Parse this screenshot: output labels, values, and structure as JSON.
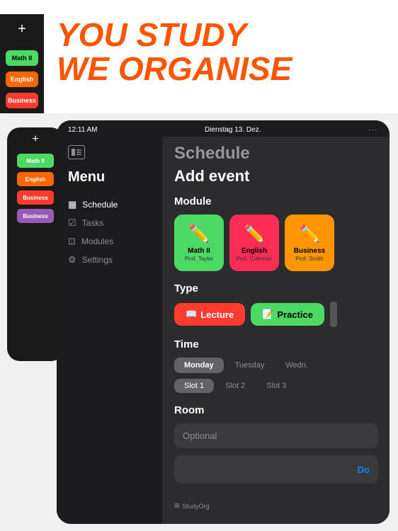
{
  "hero": {
    "headline_line1": "YOU STUDY",
    "headline_line2": "WE ORGANISE"
  },
  "left_strip": {
    "plus": "+",
    "pills": [
      {
        "label": "ath II",
        "color": "green"
      },
      {
        "label": "nglish",
        "color": "orange"
      },
      {
        "label": "iness",
        "color": "red"
      },
      {
        "label": "iness",
        "color": "purple"
      }
    ]
  },
  "ipad": {
    "status": {
      "time": "12:11 AM",
      "date": "Dienstag 13. Dez.",
      "dots": "···"
    },
    "sidebar": {
      "title": "Menu",
      "items": [
        {
          "label": "Schedule",
          "active": true
        },
        {
          "label": "Tasks"
        },
        {
          "label": "Modules"
        },
        {
          "label": "Settings"
        }
      ]
    },
    "schedule_title": "Schedule",
    "modal": {
      "title": "Add event",
      "module_label": "Module",
      "modules": [
        {
          "emoji": "✏️",
          "name": "Math II",
          "prof": "Prof. Taylor",
          "color": "green"
        },
        {
          "emoji": "✏️",
          "name": "English",
          "prof": "Prof. Coleman",
          "color": "pink"
        },
        {
          "emoji": "✏️",
          "name": "Business",
          "prof": "Prof. Smith",
          "color": "orange"
        }
      ],
      "type_label": "Type",
      "types": [
        {
          "emoji": "📖",
          "label": "Lecture",
          "style": "lecture"
        },
        {
          "emoji": "📝",
          "label": "Practice",
          "style": "practice"
        }
      ],
      "time_label": "Time",
      "days": [
        {
          "label": "Monday",
          "active": true
        },
        {
          "label": "Tuesday",
          "active": false
        },
        {
          "label": "Wedn.",
          "active": false
        }
      ],
      "slots": [
        {
          "label": "Slot 1",
          "active": true
        },
        {
          "label": "Slot 2",
          "active": false
        },
        {
          "label": "Slot 3",
          "active": false
        }
      ],
      "room_label": "Room",
      "room_placeholder": "Optional",
      "do_label": "Do"
    }
  },
  "branding": {
    "logo": "⊞",
    "label": "StudyOrg"
  }
}
